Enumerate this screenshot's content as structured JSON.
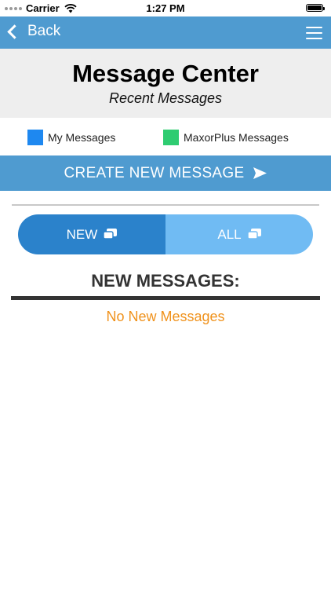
{
  "status_bar": {
    "carrier": "Carrier",
    "time": "1:27 PM"
  },
  "nav": {
    "back_label": "Back",
    "back_icon": "chevron-left-icon",
    "menu_icon": "hamburger-menu-icon"
  },
  "header": {
    "title": "Message Center",
    "subtitle": "Recent Messages"
  },
  "legend": {
    "items": [
      {
        "label": "My Messages",
        "color": "#1e88f0"
      },
      {
        "label": "MaxorPlus Messages",
        "color": "#2ecc71"
      }
    ]
  },
  "create_button": {
    "label": "CREATE NEW MESSAGE",
    "icon": "send-icon"
  },
  "tabs": [
    {
      "label": "NEW",
      "icon": "chat-bubbles-icon",
      "selected": true
    },
    {
      "label": "ALL",
      "icon": "chat-bubbles-icon",
      "selected": false
    }
  ],
  "section": {
    "title": "NEW MESSAGES:",
    "empty_text": "No New Messages"
  },
  "colors": {
    "nav_blue": "#4f9bd0",
    "tab_selected": "#2b82cb",
    "tab_unselected": "#70bbf3",
    "empty_text": "#f0921c"
  }
}
